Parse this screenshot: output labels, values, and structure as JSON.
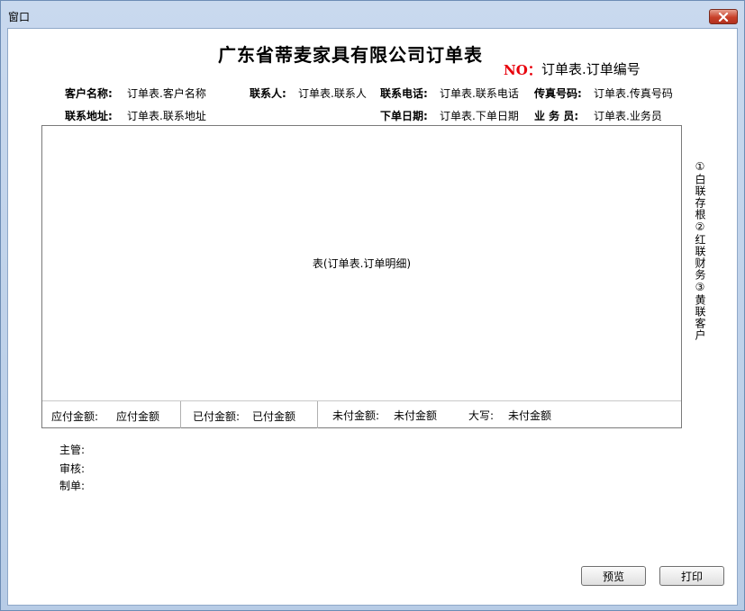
{
  "window": {
    "title": "窗口"
  },
  "report": {
    "title": "广东省蒂麦家具有限公司订单表",
    "no_label": "NO：",
    "no_value": "订单表.订单编号"
  },
  "fields": {
    "customer_name_label": "客户名称:",
    "customer_name_value": "订单表.客户名称",
    "contact_label": "联系人:",
    "contact_value": "订单表.联系人",
    "phone_label": "联系电话:",
    "phone_value": "订单表.联系电话",
    "fax_label": "传真号码:",
    "fax_value": "订单表.传真号码",
    "address_label": "联系地址:",
    "address_value": "订单表.联系地址",
    "order_date_label": "下单日期:",
    "order_date_value": "订单表.下单日期",
    "salesman_label": "业 务 员:",
    "salesman_value": "订单表.业务员"
  },
  "grid": {
    "placeholder": "表(订单表.订单明细)"
  },
  "summary": {
    "payable_label": "应付金额:",
    "payable_value": "应付金额",
    "paid_label": "已付金额:",
    "paid_value": "已付金额",
    "unpaid_label": "未付金额:",
    "unpaid_value": "未付金额",
    "capital_label": "大写:",
    "capital_value": "未付金额"
  },
  "side_note": "①白联存根②红联财务③黄联客户",
  "signatures": {
    "manager": "主管:",
    "reviewer": "审核:",
    "maker": "制单:"
  },
  "buttons": {
    "preview": "预览",
    "print": "打印"
  }
}
